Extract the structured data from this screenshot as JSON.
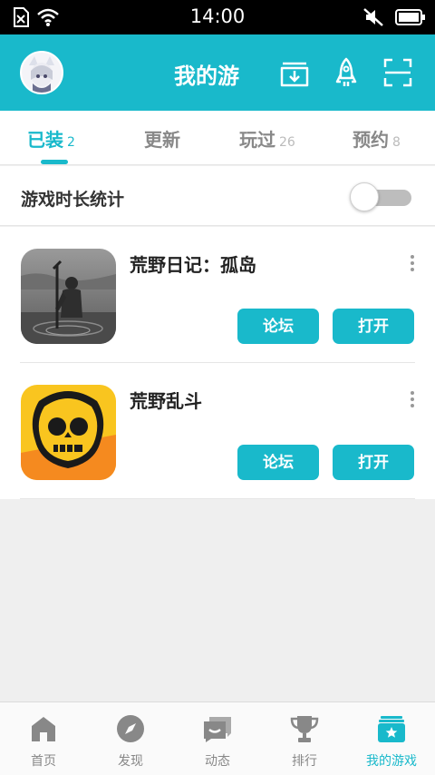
{
  "status_bar": {
    "time": "14:00"
  },
  "header": {
    "title": "我的游"
  },
  "tabs": [
    {
      "label": "已装",
      "count": "2",
      "active": true
    },
    {
      "label": "更新",
      "count": "",
      "active": false
    },
    {
      "label": "玩过",
      "count": "26",
      "active": false
    },
    {
      "label": "预约",
      "count": "8",
      "active": false
    }
  ],
  "playtime_stats": {
    "label": "游戏时长统计",
    "enabled": false
  },
  "games": [
    {
      "name": "荒野日记：孤岛",
      "forum_label": "论坛",
      "open_label": "打开"
    },
    {
      "name": "荒野乱斗",
      "forum_label": "论坛",
      "open_label": "打开"
    }
  ],
  "bottom_nav": [
    {
      "label": "首页",
      "icon": "home-icon",
      "active": false
    },
    {
      "label": "发现",
      "icon": "compass-icon",
      "active": false
    },
    {
      "label": "动态",
      "icon": "chat-bubble-icon",
      "active": false
    },
    {
      "label": "排行",
      "icon": "trophy-icon",
      "active": false
    },
    {
      "label": "我的游戏",
      "icon": "game-box-icon",
      "active": true
    }
  ],
  "colors": {
    "accent": "#19b9cb",
    "inactive": "#888888"
  }
}
